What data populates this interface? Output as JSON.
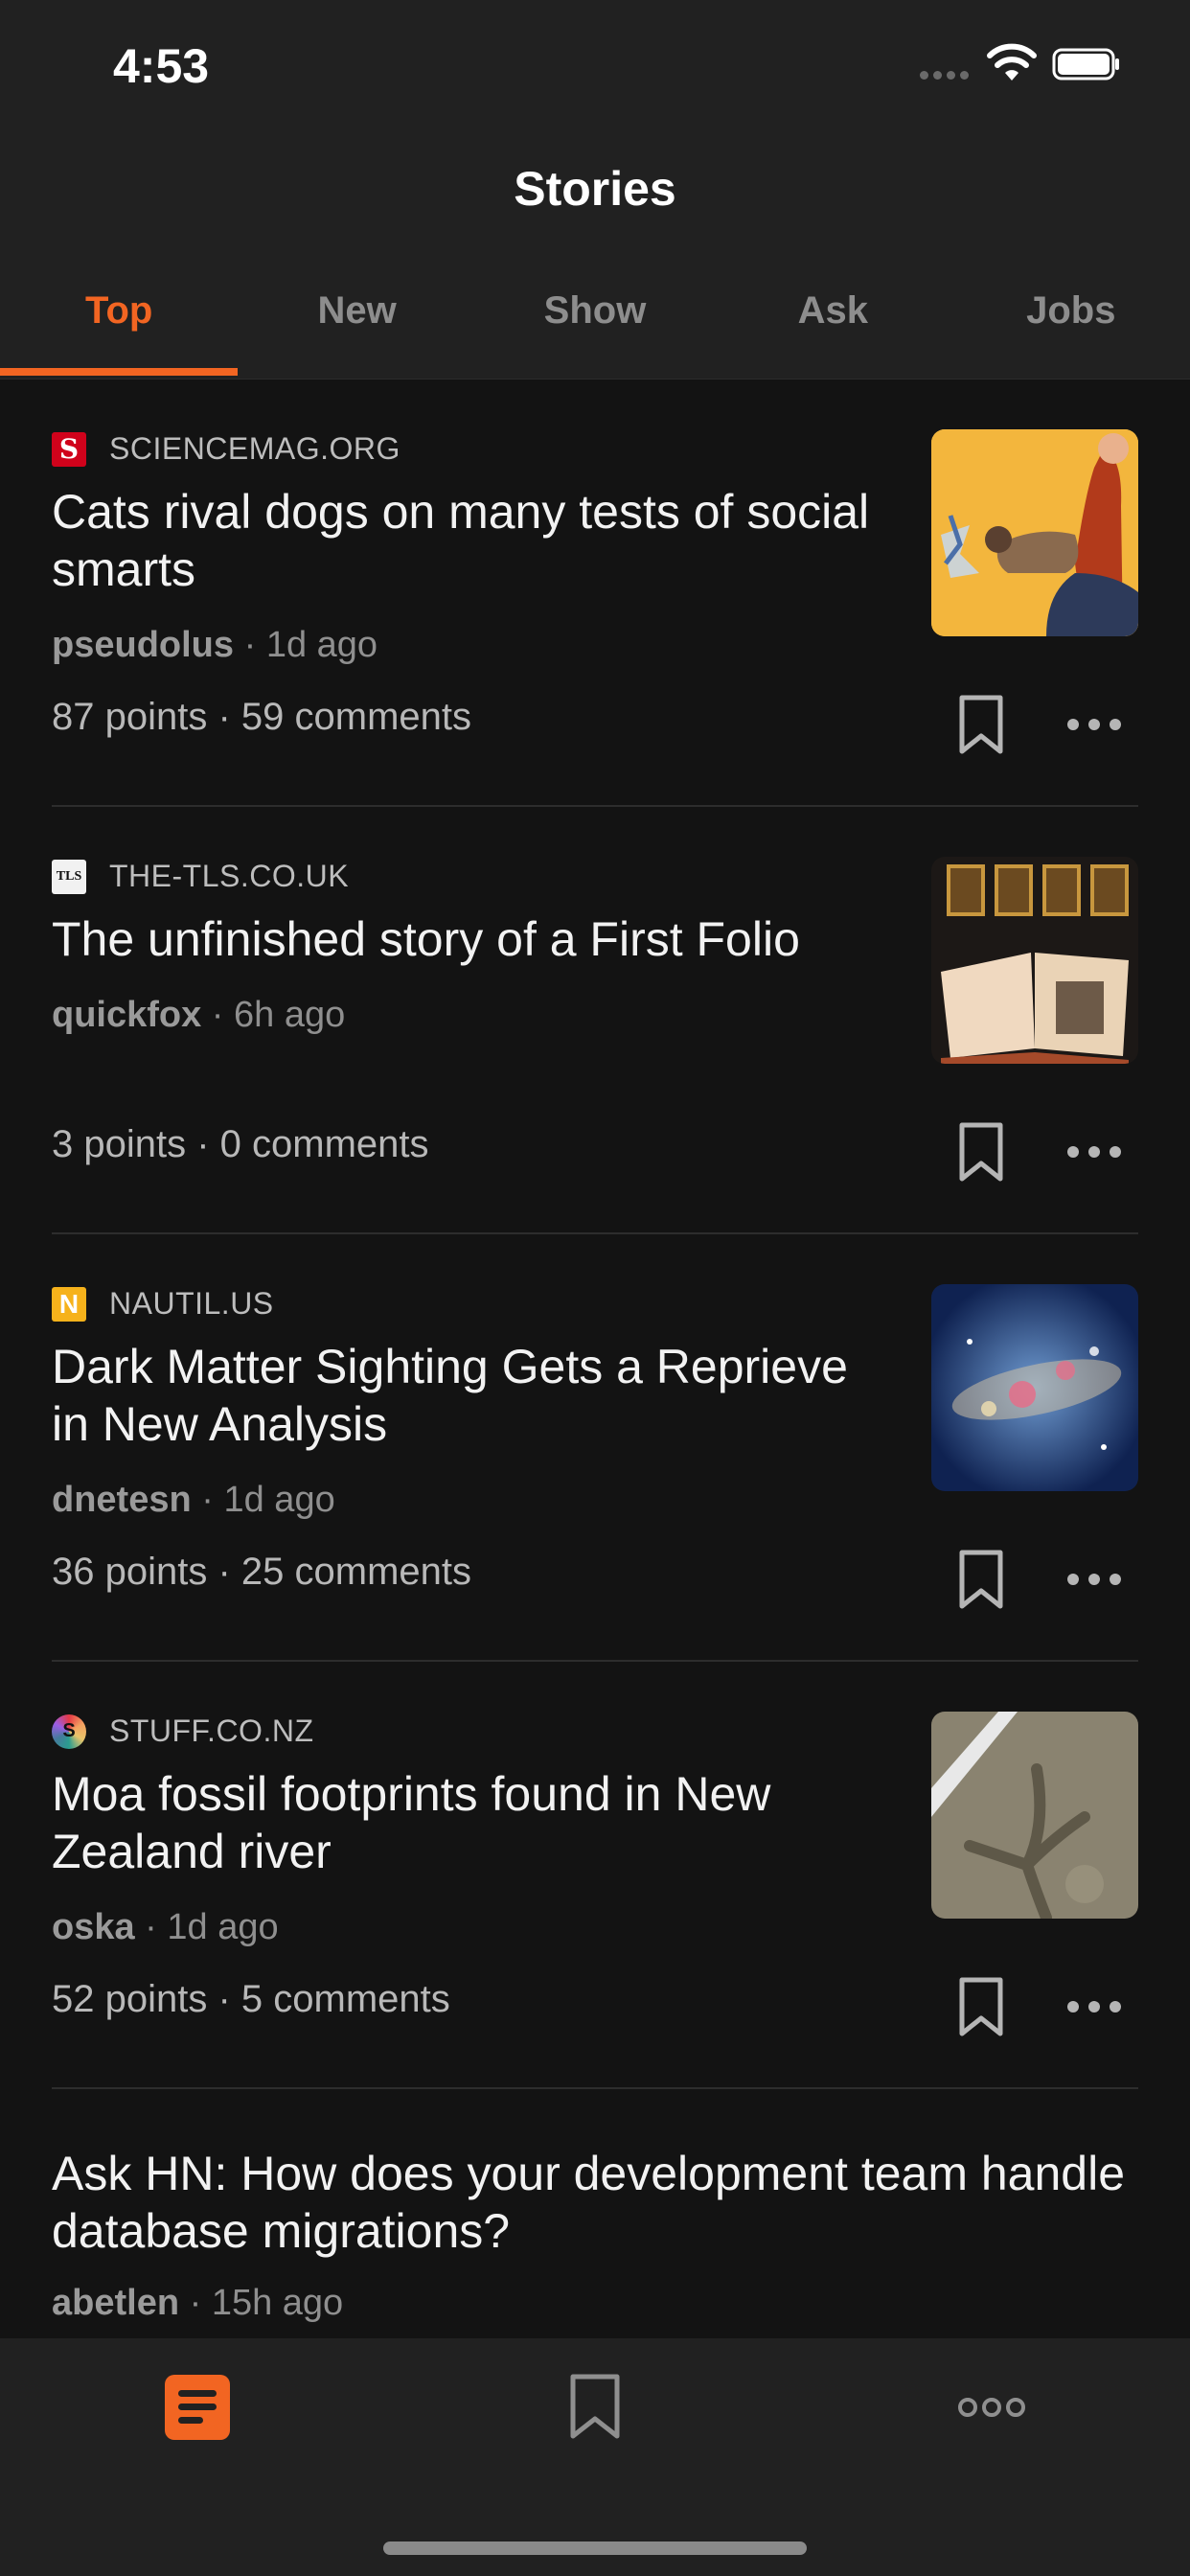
{
  "status_bar": {
    "time": "4:53"
  },
  "header": {
    "title": "Stories"
  },
  "tabs": [
    {
      "label": "Top",
      "active": true
    },
    {
      "label": "New",
      "active": false
    },
    {
      "label": "Show",
      "active": false
    },
    {
      "label": "Ask",
      "active": false
    },
    {
      "label": "Jobs",
      "active": false
    }
  ],
  "stories": [
    {
      "source": "SCIENCEMAG.ORG",
      "favicon_text": "S",
      "title": "Cats rival dogs on many tests of social smarts",
      "author": "pseudolus",
      "age": "1d ago",
      "stats": "87 points · 59 comments"
    },
    {
      "source": "THE-TLS.CO.UK",
      "favicon_text": "TLS",
      "title": "The unfinished story of a First Folio",
      "author": "quickfox",
      "age": "6h ago",
      "stats": "3 points · 0 comments"
    },
    {
      "source": "NAUTIL.US",
      "favicon_text": "N",
      "title": "Dark Matter Sighting Gets a Reprieve in New Analysis",
      "author": "dnetesn",
      "age": "1d ago",
      "stats": "36 points · 25 comments"
    },
    {
      "source": "STUFF.CO.NZ",
      "favicon_text": "S",
      "title": "Moa fossil footprints found in New Zealand river",
      "author": "oska",
      "age": "1d ago",
      "stats": "52 points · 5 comments"
    },
    {
      "title": "Ask HN: How does your development team handle database migrations?",
      "author": "abetlen",
      "age": "15h ago"
    }
  ],
  "colors": {
    "accent": "#f26522",
    "background": "#131313",
    "header": "#212121"
  },
  "tab_bar": {
    "icons": [
      "stories-icon",
      "bookmark-icon",
      "more-icon"
    ]
  }
}
